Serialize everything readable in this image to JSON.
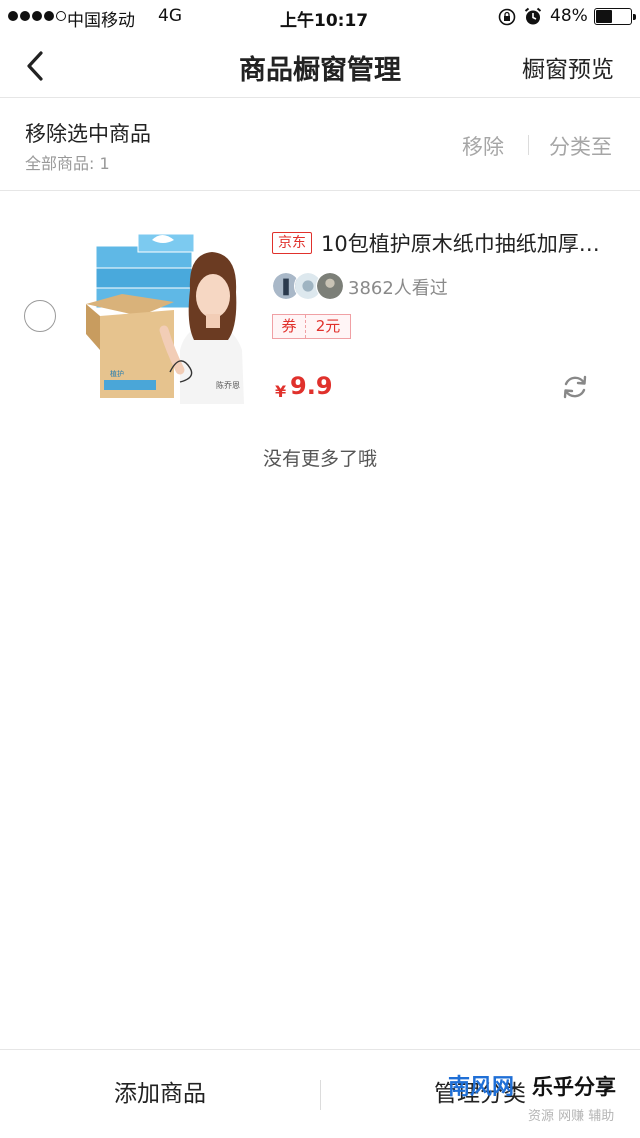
{
  "status_bar": {
    "carrier": "中国移动",
    "network": "4G",
    "time": "上午10:17",
    "battery": "48%",
    "battery_level": 0.48
  },
  "nav": {
    "title": "商品橱窗管理",
    "preview": "橱窗预览"
  },
  "actions": {
    "title": "移除选中商品",
    "total": "全部商品: 1",
    "remove": "移除",
    "move_to_category": "分类至"
  },
  "product": {
    "shop": "京东",
    "title": "10包植护原木纸巾抽纸加厚…",
    "viewers": "3862人看过",
    "coupon_label": "券",
    "coupon_value": "2元",
    "price_symbol": "¥",
    "price": "9.9",
    "image_name": "tissue-box-promo-image",
    "image_text": "植护",
    "signature": "陈乔恩"
  },
  "footer_note": "没有更多了哦",
  "bottom": {
    "add": "添加商品",
    "manage": "管理分类"
  },
  "watermark": {
    "line1": "南风网",
    "line2": "乐乎分享",
    "line3": "资源 网赚 辅助"
  },
  "colors": {
    "accent_red": "#e0312c",
    "muted_text": "#a6a6a6",
    "divider": "#e6e6e6"
  }
}
